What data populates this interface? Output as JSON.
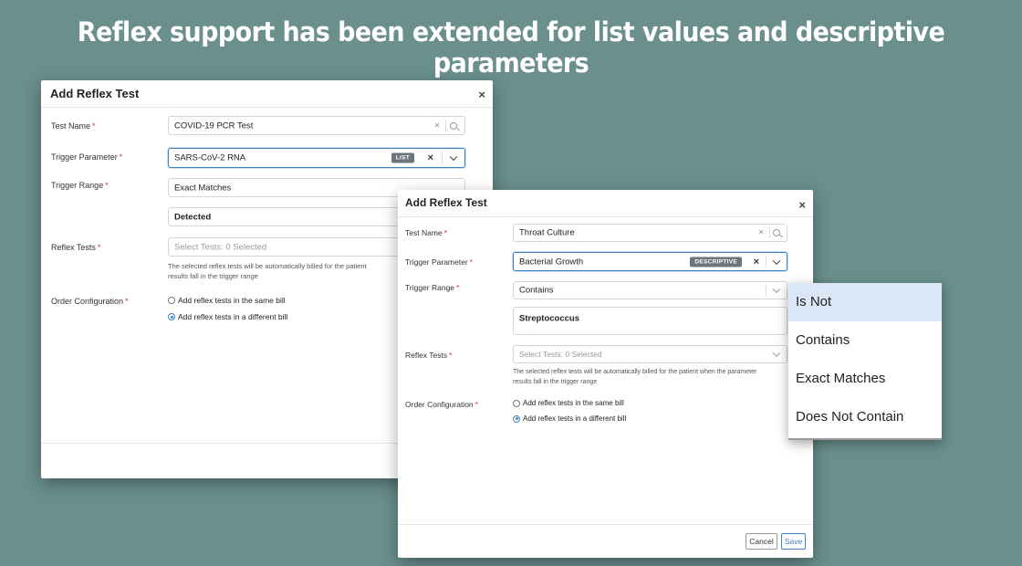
{
  "headline": "Reflex support has been extended for list values and descriptive parameters",
  "modal1": {
    "title": "Add Reflex Test",
    "close": "×",
    "test_name_label": "Test Name",
    "test_name_value": "COVID-19 PCR Test",
    "trigger_param_label": "Trigger Parameter",
    "trigger_param_value": "SARS-CoV-2 RNA",
    "trigger_param_badge": "LIST",
    "trigger_range_label": "Trigger Range",
    "trigger_range_value": "Exact Matches",
    "range_value": "Detected",
    "reflex_tests_label": "Reflex Tests",
    "reflex_tests_placeholder": "Select Tests: 0 Selected",
    "hint_line1": "The selected reflex tests will be automatically billed for the patient",
    "hint_line2": "results fall in the trigger range",
    "order_config_label": "Order Configuration",
    "option_same": "Add reflex tests in the same bill",
    "option_different": "Add reflex tests in a different bill",
    "required_mark": "*"
  },
  "modal2": {
    "title": "Add Reflex Test",
    "close": "×",
    "test_name_label": "Test Name",
    "test_name_value": "Throat Culture",
    "trigger_param_label": "Trigger Parameter",
    "trigger_param_value": "Bacterial Growth",
    "trigger_param_badge": "DESCRIPTIVE",
    "trigger_range_label": "Trigger Range",
    "trigger_range_value": "Contains",
    "range_value": "Streptococcus",
    "reflex_tests_label": "Reflex Tests",
    "reflex_tests_placeholder": "Select Tests: 0 Selected",
    "hint_line1": "The selected reflex tests will be automatically billed for the patient when the parameter",
    "hint_line2": "results fall in the trigger range",
    "order_config_label": "Order Configuration",
    "option_same": "Add reflex tests in the same bill",
    "option_different": "Add reflex tests in a different bill",
    "cancel_label": "Cancel",
    "save_label": "Save",
    "required_mark": "*"
  },
  "dropdown": {
    "items": [
      "Is Not",
      "Contains",
      "Exact Matches",
      "Does Not Contain"
    ],
    "highlighted": "Is Not"
  },
  "icons": {
    "clear": "×",
    "close": "×"
  },
  "colors": {
    "background": "#6a8f8d",
    "accent": "#3b82c4",
    "badge": "#6c757d",
    "highlight": "#dbe6f6"
  }
}
